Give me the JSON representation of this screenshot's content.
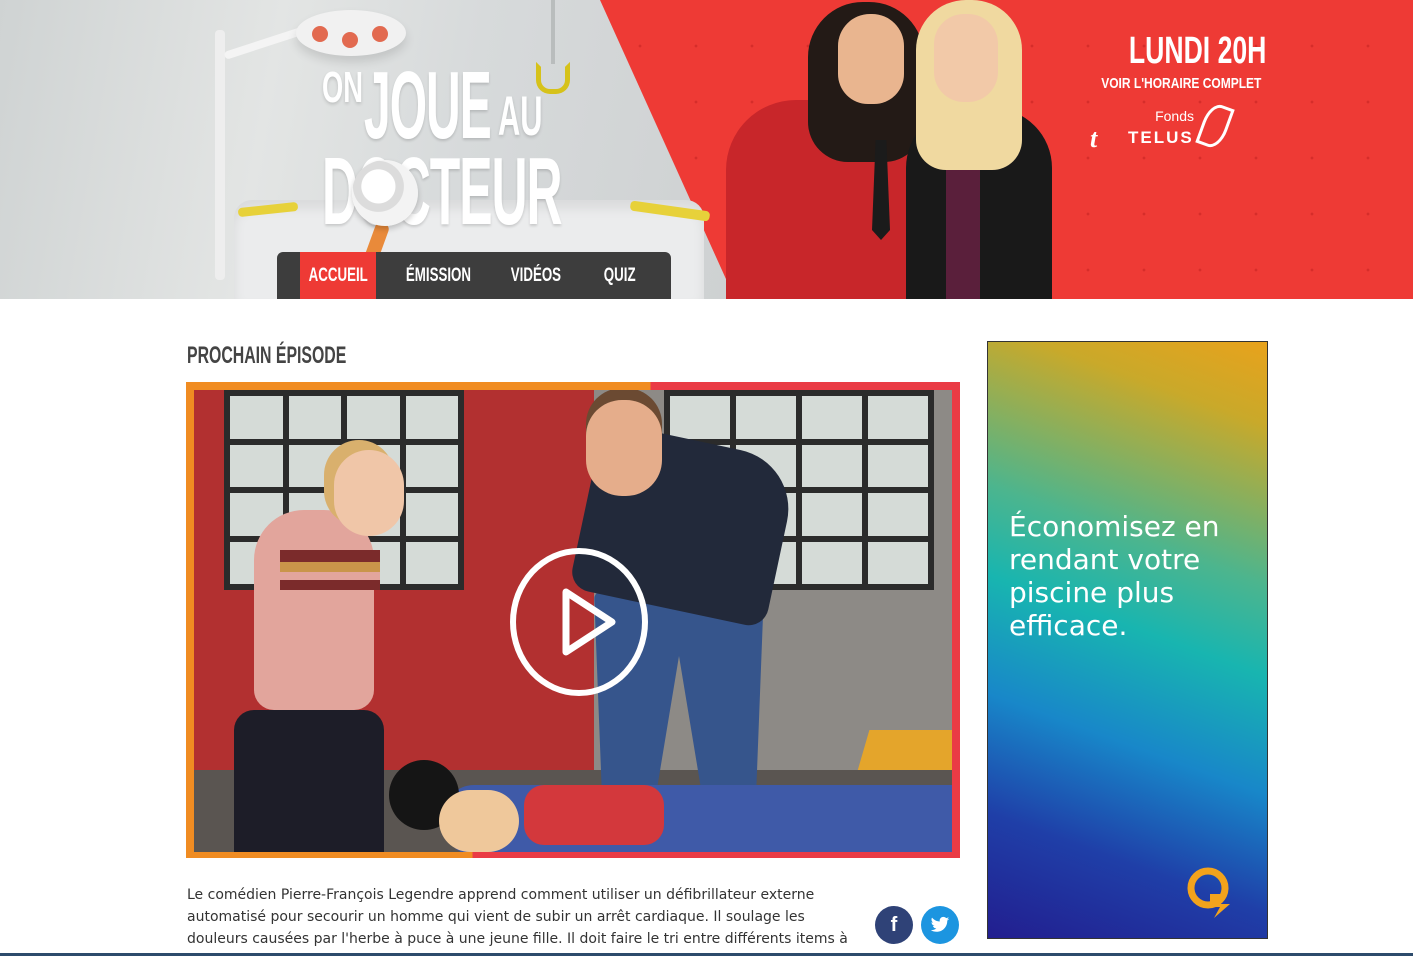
{
  "header": {
    "logo": {
      "line1_small": "ON",
      "line1_big": "JOUE",
      "line1_tail": "AU",
      "line2": "DOCTEUR"
    },
    "nav": [
      {
        "label": "ACCUEIL",
        "active": true
      },
      {
        "label": "ÉMISSION",
        "active": false
      },
      {
        "label": "VIDÉOS",
        "active": false
      },
      {
        "label": "QUIZ",
        "active": false
      }
    ],
    "airtime": {
      "day_time": "LUNDI 20H",
      "schedule_link": "VOIR L'HORAIRE COMPLET"
    },
    "sponsor": {
      "prefix": "Fonds",
      "name": "TELUS"
    }
  },
  "main": {
    "section_title": "PROCHAIN ÉPISODE",
    "description": "Le comédien Pierre-François Legendre apprend comment utiliser un défibrillateur externe automatisé pour secourir un homme qui vient de subir un arrêt cardiaque.  Il soulage les douleurs causées par l'herbe à puce à une jeune fille.  Il doit faire le tri entre différents items à utiliser ou à proscrire pour"
  },
  "ad": {
    "text": "Économisez en rendant votre piscine plus efficace.",
    "logo_icon": "hydro-quebec-q-icon"
  },
  "social": {
    "facebook_glyph": "f",
    "twitter_icon": "twitter-bird-icon"
  },
  "colors": {
    "accent_red": "#ee3a35",
    "nav_bg": "#3d3d3d",
    "frame_orange": "#f08c22",
    "frame_red": "#ea3b45",
    "facebook": "#2f4277",
    "twitter": "#1c95e0"
  }
}
